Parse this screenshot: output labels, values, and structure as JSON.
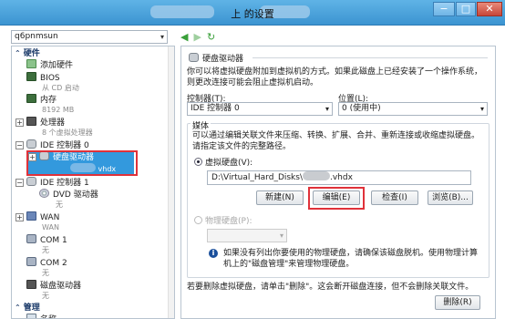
{
  "window": {
    "title": "上                    的设置",
    "minimize": "−",
    "maximize": "□",
    "close": "✕"
  },
  "vm_selector": {
    "value": "q6pnmsun"
  },
  "tree": {
    "hardware_header": "硬件",
    "add_hardware": "添加硬件",
    "bios": "BIOS",
    "bios_sub": "从 CD 启动",
    "memory": "内存",
    "memory_sub": "8192 MB",
    "processor": "处理器",
    "processor_sub": "8 个虚拟处理器",
    "ide0": "IDE 控制器 0",
    "hard_drive": "硬盘驱动器",
    "hard_drive_sub": "vhdx",
    "ide1": "IDE 控制器 1",
    "dvd": "DVD 驱动器",
    "dvd_sub": "无",
    "wan": "WAN",
    "wan_sub": "WAN",
    "com1": "COM 1",
    "com1_sub": "无",
    "com2": "COM 2",
    "com2_sub": "无",
    "floppy": "磁盘驱动器",
    "floppy_sub": "无",
    "management_header": "管理",
    "name": "名称"
  },
  "panel": {
    "title": "硬盘驱动器",
    "description": "你可以将虚拟硬盘附加到虚拟机的方式。如果此磁盘上已经安装了一个操作系统，则更改连接可能会阻止虚拟机启动。",
    "controller_label": "控制器(T):",
    "controller_value": "IDE 控制器 0",
    "location_label": "位置(L):",
    "location_value": "0 (使用中)",
    "media_label": "媒体",
    "media_description": "可以通过编辑关联文件来压缩、转换、扩展、合并、重新连接或收缩虚拟硬盘。请指定该文件的完整路径。",
    "virtual_disk_label": "虚拟硬盘(V):",
    "path_prefix": "D:\\Virtual_Hard_Disks\\",
    "path_suffix": ".vhdx",
    "new_button": "新建(N)",
    "edit_button": "编辑(E)",
    "inspect_button": "检查(I)",
    "browse_button": "浏览(B)...",
    "physical_disk_label": "物理硬盘(P):",
    "info_text": "如果没有列出你要使用的物理硬盘，请确保该磁盘脱机。使用物理计算机上的\"磁盘管理\"来管理物理硬盘。",
    "remove_text": "若要删除虚拟硬盘，请单击\"删除\"。这会断开磁盘连接，但不会删除关联文件。",
    "remove_button": "删除(R)"
  },
  "colors": {
    "titlebar": "#3c94d1",
    "selection": "#3399dd",
    "highlight_box": "#e0323a"
  }
}
